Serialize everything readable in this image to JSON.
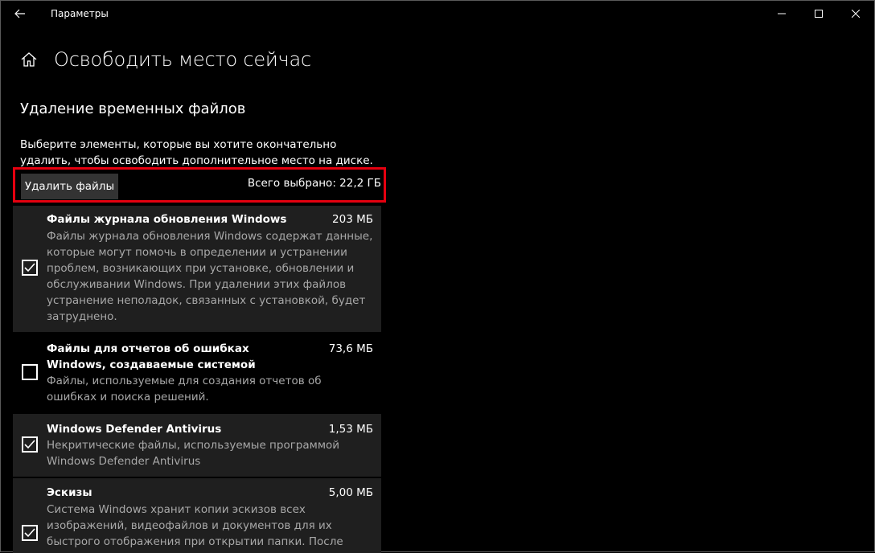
{
  "window": {
    "title": "Параметры",
    "back_icon": "back-arrow-icon",
    "controls": [
      "minimize-icon",
      "maximize-icon",
      "close-icon"
    ]
  },
  "header": {
    "home_icon": "home-icon",
    "title": "Освободить место сейчас"
  },
  "section": {
    "title": "Удаление временных файлов",
    "description": "Выберите элементы, которые вы хотите окончательно удалить, чтобы освободить дополнительное место на диске."
  },
  "actions": {
    "delete_label": "Удалить файлы",
    "total_selected": "Всего выбрано: 22,2 ГБ",
    "highlight_color": "#e5000f"
  },
  "items": [
    {
      "name": "Файлы журнала обновления Windows",
      "size": "203 МБ",
      "checked": true,
      "description": "Файлы журнала обновления Windows содержат данные, которые могут помочь в определении и устранении проблем, возникающих при установке, обновлении и обслуживании Windows. При удалении этих файлов устранение неполадок, связанных с установкой, будет затруднено."
    },
    {
      "name": "Файлы для отчетов об ошибках Windows, создаваемые системой",
      "size": "73,6 МБ",
      "checked": false,
      "description": "Файлы, используемые для создания отчетов об ошибках и поиска решений."
    },
    {
      "name": "Windows Defender Antivirus",
      "size": "1,53 МБ",
      "checked": true,
      "description": "Некритические файлы, используемые программой Windows Defender Antivirus"
    },
    {
      "name": "Эскизы",
      "size": "5,00 МБ",
      "checked": true,
      "description": "Система Windows хранит копии эскизов всех изображений, видеофайлов и документов для их быстрого отображения при открытии папки. После"
    }
  ]
}
